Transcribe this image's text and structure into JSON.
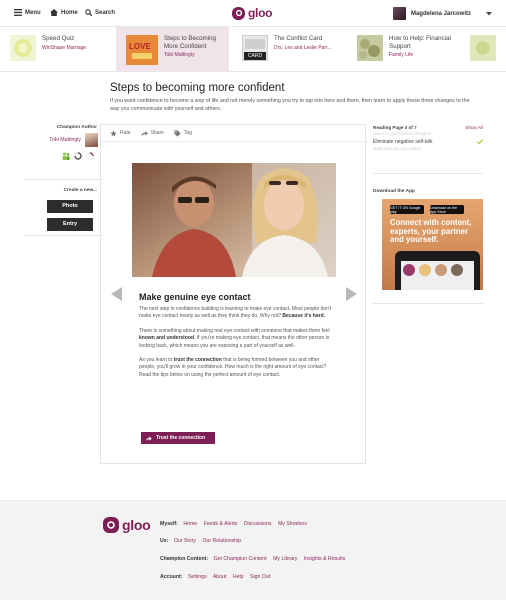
{
  "topbar": {
    "menu_label": "Menu",
    "home_label": "Home",
    "search_label": "Search",
    "logo_text": "gloo",
    "user_name": "Magdelena Jarcowitz"
  },
  "carousel": [
    {
      "title": "Speed Quiz",
      "subtitle": "WinShape Marriage"
    },
    {
      "title": "Steps to Becoming More Confident",
      "subtitle": "Tobi Mattingly"
    },
    {
      "title": "The Conflict Card",
      "subtitle": "Drs. Les and Leslie Parr..."
    },
    {
      "title": "How to Help: Financial Support",
      "subtitle": "Family Life"
    }
  ],
  "thumb_texts": {
    "love": "LOVE",
    "card": "CARD"
  },
  "page": {
    "title": "Steps to becoming more confident",
    "description": "If you want confidence to become a way of life and not merely something you try to tap into here and there, then learn to apply these three changes to the way you communicate with yourself and others."
  },
  "left": {
    "author_label": "Champion Author",
    "author_name": "Tobi Mattingly",
    "create_label": "Create a new...",
    "photo_button": "Photo",
    "entry_button": "Entry"
  },
  "actions": {
    "rate": "Rate",
    "share": "Share",
    "tag": "Tag"
  },
  "article": {
    "title": "Make genuine eye contact",
    "p1": "The next step in confidence building is learning to make eye contact. Most people don't make eye contact nearly as well as they think they do. Why not?",
    "p1_bold": "Because it's hard.",
    "p2a": "There is something about making real eye contact with someone that makes them feel",
    "p2_bold": "known and understood",
    "p2b": ". If you're making eye contact, that means the other person is looking back, which means you are exposing a part of yourself as well.",
    "p3a": "As you learn to",
    "p3_bold": "trust the connection",
    "p3b": "that is being formed between you and other people, you'll grow in your confidence. How much is the right amount of eye contact? Read the tips below on using the perfect amount of eye contact.",
    "cta": "Trust the connection"
  },
  "right": {
    "reading_label": "Reading Page 3 of 7",
    "show_all": "Show All",
    "item_faded_top": "Listen to your positive thoughts",
    "item_current": "Eliminate negative self-talk",
    "item_faded_bottom": "Make genuine eye contact",
    "download_label": "Download the App",
    "ad_text": "Connect with content, experts, your partner and yourself.",
    "google_play": "GET IT ON Google play",
    "app_store": "Download on the App Store"
  },
  "footer": {
    "logo_text": "gloo",
    "myself_label": "Myself:",
    "myself_links": [
      "Home",
      "Feeds & Alerts",
      "Discussions",
      "My Shoebox"
    ],
    "us_label": "Us:",
    "us_links": [
      "Our Story",
      "Our Relationship"
    ],
    "champion_label": "Champion Content:",
    "champion_links": [
      "Get Champion Content",
      "My Library",
      "Insights & Results"
    ],
    "account_label": "Account:",
    "account_links": [
      "Settings",
      "About",
      "Help",
      "Sign Out"
    ]
  },
  "colors": {
    "brand": "#7d1f55",
    "dark_button": "#2c2c2c",
    "link": "#8a2a5c",
    "check": "#c2c21a"
  }
}
